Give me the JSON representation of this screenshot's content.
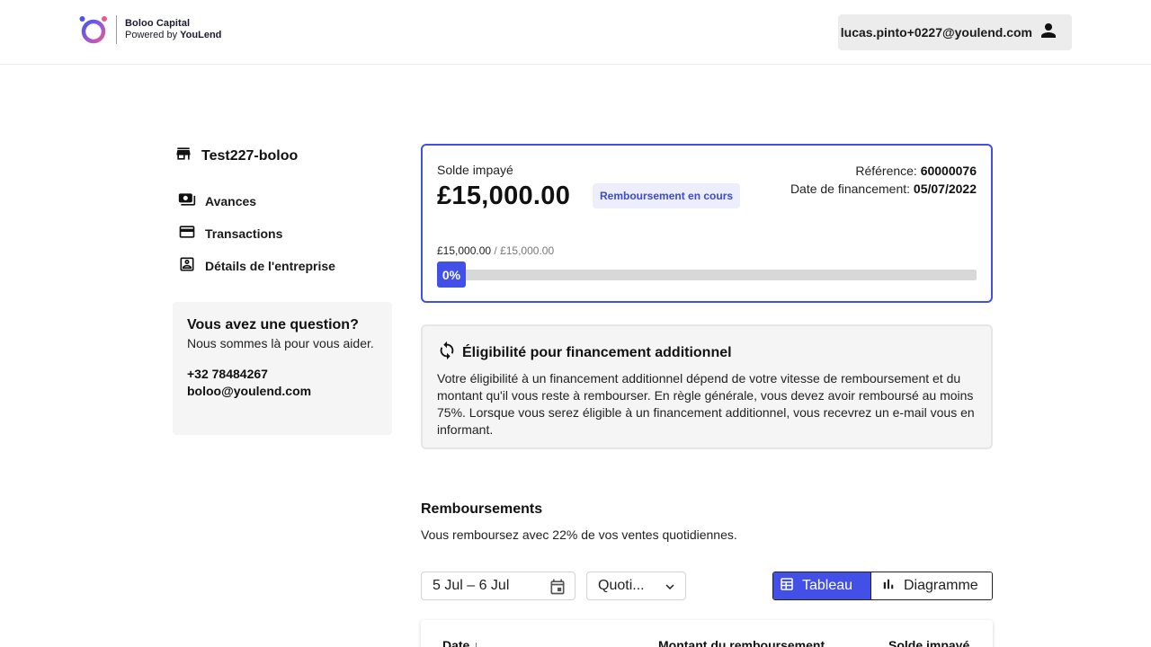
{
  "header": {
    "brand_name": "Boloo Capital",
    "powered_prefix": "Powered by",
    "powered_brand": "YouLend",
    "user_email": "lucas.pinto+0227@youlend.com"
  },
  "sidebar": {
    "company_name": "Test227-boloo",
    "items": [
      {
        "label": "Avances",
        "icon": "cash-icon"
      },
      {
        "label": "Transactions",
        "icon": "credit-card-icon"
      },
      {
        "label": "Détails de l'entreprise",
        "icon": "contact-card-icon"
      }
    ],
    "help": {
      "title": "Vous avez une question?",
      "subtitle": "Nous sommes là pour vous aider.",
      "phone": "+32 78484267",
      "email": "boloo@youlend.com"
    }
  },
  "balance": {
    "label": "Solde impayé",
    "amount": "£15,000.00",
    "status_badge": "Remboursement en cours",
    "reference_label": "Référence:",
    "reference_value": "60000076",
    "funding_date_label": "Date de financement:",
    "funding_date_value": "05/07/2022",
    "progress_current": "£15,000.00",
    "progress_total": "£15,000.00",
    "progress_percent_label": "0%",
    "progress_fraction": 0.0
  },
  "eligibility": {
    "title": "Éligibilité pour financement additionnel",
    "body": "Votre éligibilité à un financement additionnel dépend de votre vitesse de remboursement et du montant qu'il vous reste à rembourser. En règle générale, vous devez avoir remboursé au moins 75%. Lorsque vous serez éligible à un financement additionnel, vous recevrez un e-mail vous en informant."
  },
  "repayments": {
    "title": "Remboursements",
    "subtitle": "Vous remboursez avec 22% de vos ventes quotidiennes.",
    "date_range": "5 Jul – 6 Jul",
    "frequency": "Quoti...",
    "view_table": "Tableau",
    "view_chart": "Diagramme",
    "columns": [
      "Date",
      "Montant du remboursement",
      "Solde impayé"
    ]
  },
  "colors": {
    "accent": "#4350e8",
    "badge_bg": "#eceefc"
  }
}
